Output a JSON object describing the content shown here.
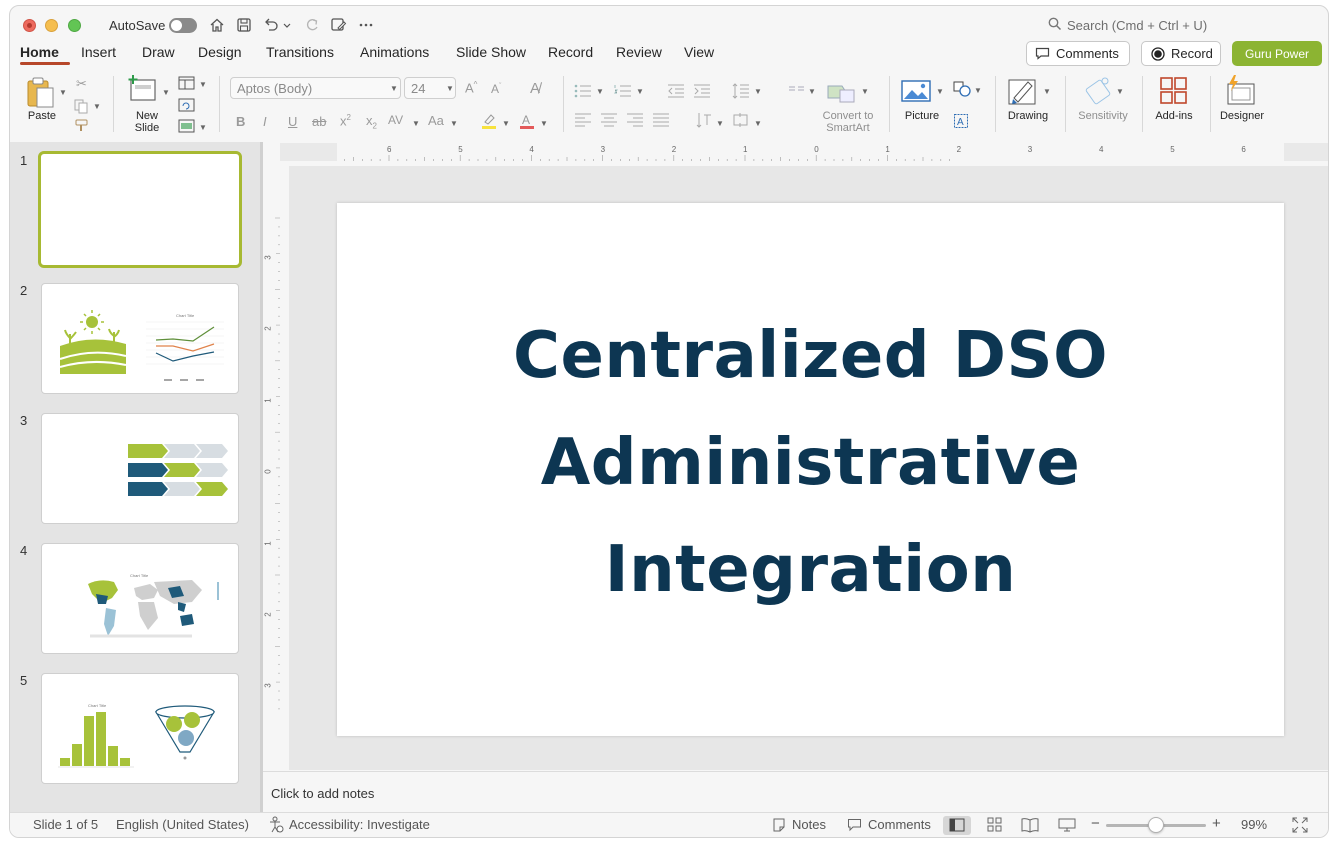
{
  "titlebar": {
    "autosave_label": "AutoSave",
    "search_placeholder": "Search (Cmd + Ctrl + U)"
  },
  "tabs": [
    {
      "label": "Home",
      "active": true
    },
    {
      "label": "Insert"
    },
    {
      "label": "Draw"
    },
    {
      "label": "Design"
    },
    {
      "label": "Transitions"
    },
    {
      "label": "Animations"
    },
    {
      "label": "Slide Show"
    },
    {
      "label": "Record"
    },
    {
      "label": "Review"
    },
    {
      "label": "View"
    }
  ],
  "header_buttons": {
    "comments": "Comments",
    "record": "Record",
    "guru": "Guru Power"
  },
  "ribbon": {
    "paste": "Paste",
    "new_slide_line1": "New",
    "new_slide_line2": "Slide",
    "font_name": "Aptos (Body)",
    "font_size": "24",
    "convert_line1": "Convert to",
    "convert_line2": "SmartArt",
    "picture": "Picture",
    "drawing": "Drawing",
    "sensitivity": "Sensitivity",
    "addins": "Add-ins",
    "designer": "Designer"
  },
  "ruler": {
    "h_ticks": [
      "6",
      "5",
      "4",
      "3",
      "2",
      "1",
      "0",
      "1",
      "2",
      "3",
      "4",
      "5",
      "6"
    ],
    "v_ticks": [
      "3",
      "2",
      "1",
      "0",
      "1",
      "2",
      "3"
    ]
  },
  "thumbnails": {
    "numbers": [
      "1",
      "2",
      "3",
      "4",
      "5"
    ],
    "chart_title": "Chart Title"
  },
  "slide": {
    "title_lines": [
      "Centralized DSO",
      "Administrative",
      "Integration"
    ]
  },
  "notes": {
    "placeholder": "Click to add notes"
  },
  "statusbar": {
    "slide_info": "Slide 1 of 5",
    "language": "English (United States)",
    "accessibility": "Accessibility: Investigate",
    "notes": "Notes",
    "comments": "Comments",
    "zoom": "99%"
  },
  "colors": {
    "accent_tab": "#b7472a",
    "guru": "#8cb432",
    "title_text": "#0d3652",
    "thumb_green": "#a7c23a",
    "thumb_navy": "#1f5a7a"
  }
}
